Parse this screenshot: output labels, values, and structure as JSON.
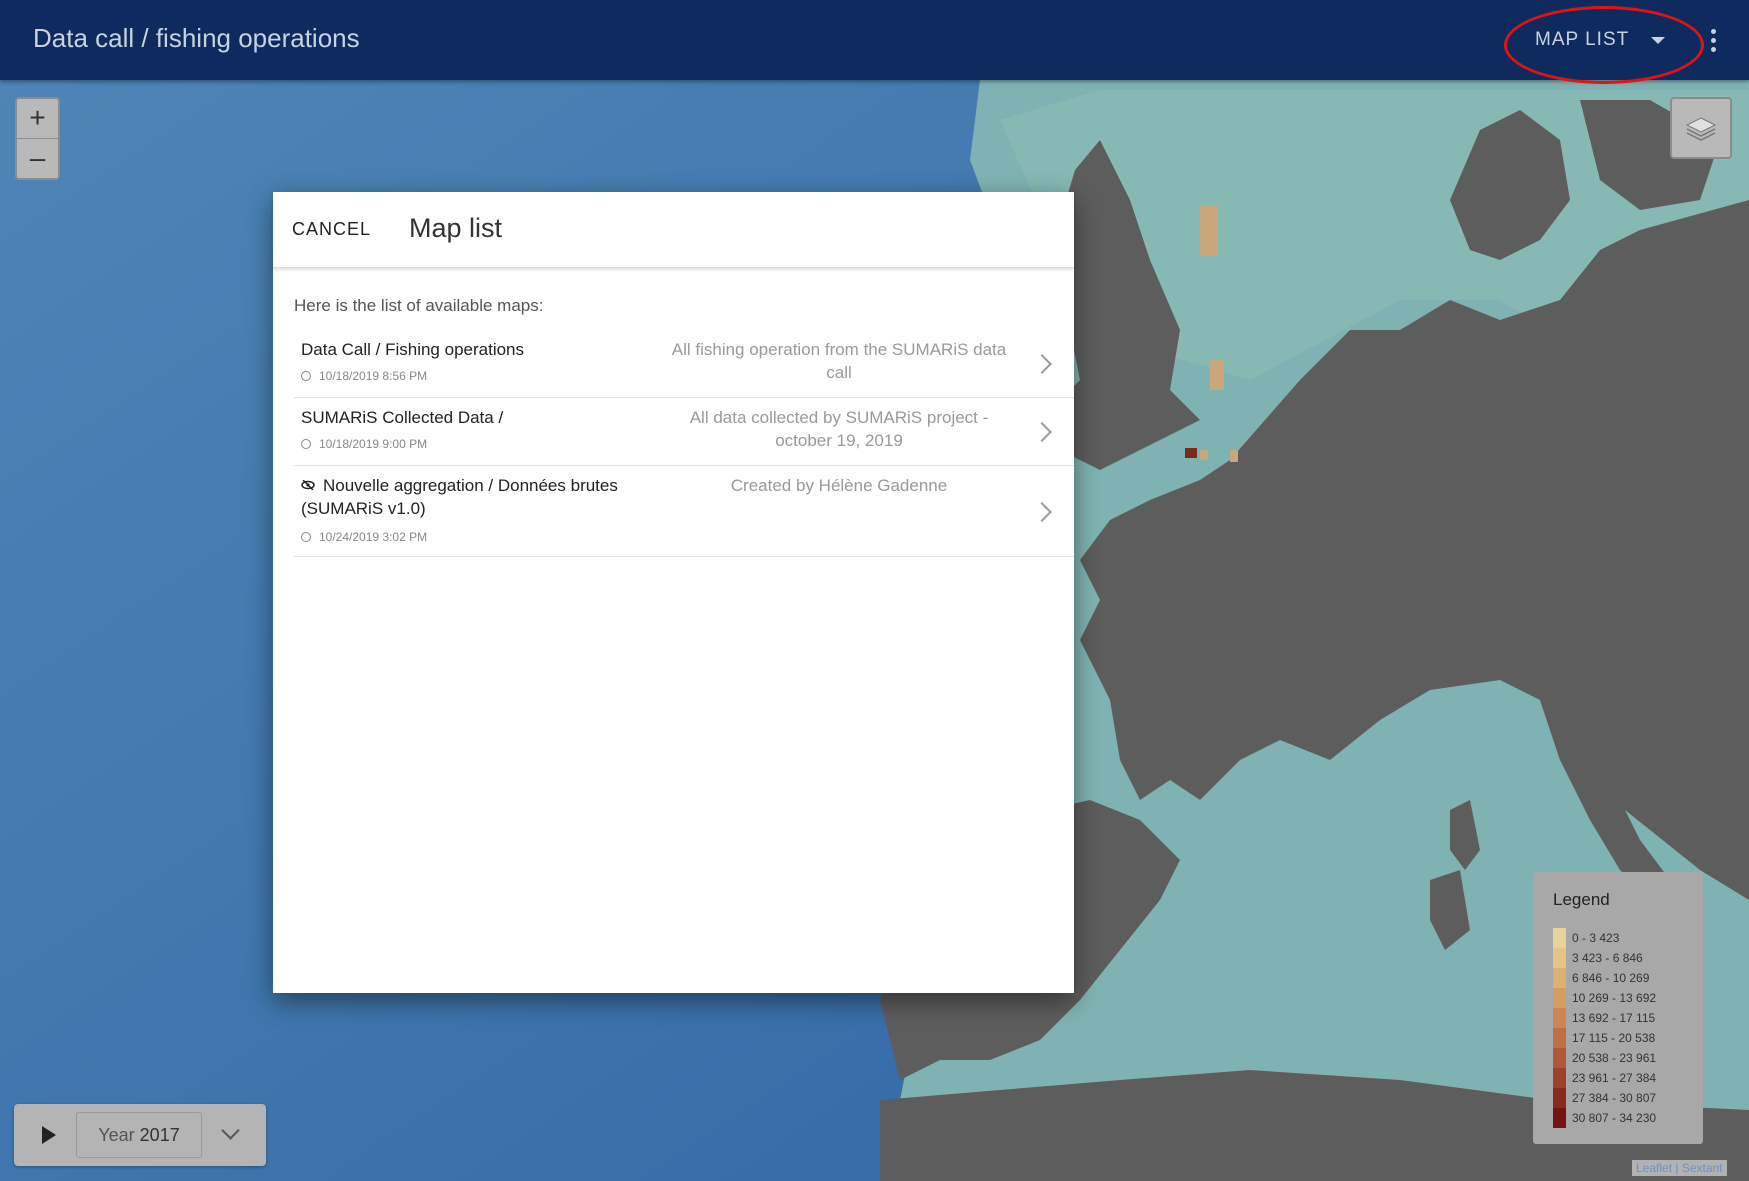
{
  "header": {
    "title": "Data call / fishing operations",
    "map_list_label": "MAP LIST"
  },
  "map_controls": {
    "zoom_in": "+",
    "zoom_out": "–",
    "attribution": "Leaflet | Sextant"
  },
  "timeline": {
    "prefix": "Year",
    "year": "2017"
  },
  "legend": {
    "title": "Legend",
    "entries": [
      {
        "label": "0 - 3 423",
        "color": "#e8d49a"
      },
      {
        "label": "3 423 - 6 846",
        "color": "#e3c587"
      },
      {
        "label": "6 846 - 10 269",
        "color": "#dbb274"
      },
      {
        "label": "10 269 - 13 692",
        "color": "#d49d63"
      },
      {
        "label": "13 692 - 17 115",
        "color": "#ca8754"
      },
      {
        "label": "17 115 - 20 538",
        "color": "#bd7046"
      },
      {
        "label": "20 538 - 23 961",
        "color": "#ae5939"
      },
      {
        "label": "23 961 - 27 384",
        "color": "#9c412c"
      },
      {
        "label": "27 384 - 30 807",
        "color": "#882a1f"
      },
      {
        "label": "30 807 - 34 230",
        "color": "#721514"
      }
    ]
  },
  "dialog": {
    "cancel_label": "CANCEL",
    "title": "Map list",
    "intro": "Here is the list of available maps:",
    "items": [
      {
        "name": "Data Call / Fishing operations",
        "date": "10/18/2019 8:56 PM",
        "description": "All fishing operation from the SUMARiS data call",
        "hidden": false
      },
      {
        "name": "SUMARiS Collected Data /",
        "date": "10/18/2019 9:00 PM",
        "description": "All data collected by SUMARiS project - october 19, 2019",
        "hidden": false
      },
      {
        "name": "Nouvelle aggregation / Données brutes (SUMARiS v1.0)",
        "date": "10/24/2019 3:02 PM",
        "description": "Created by Hélène Gadenne",
        "hidden": true
      }
    ]
  }
}
